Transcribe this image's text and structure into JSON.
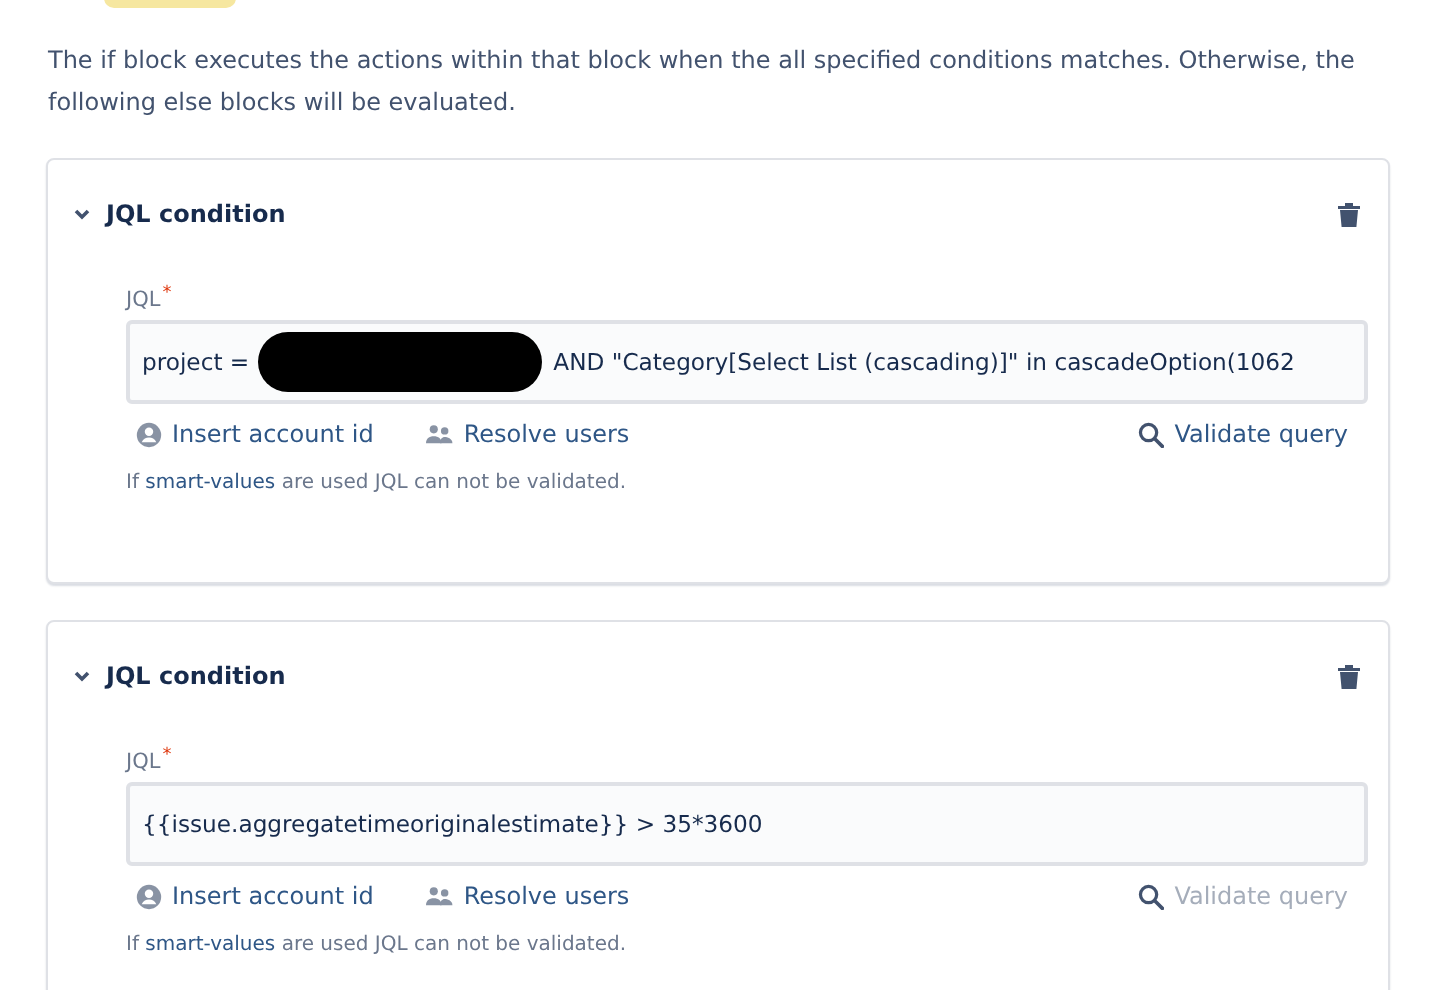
{
  "description": "The if block executes the actions within that block when the all specified conditions matches. Otherwise, the following else blocks will be evaluated.",
  "conditions": [
    {
      "title": "JQL condition",
      "expanded": true,
      "field_label": "JQL",
      "required_mark": "*",
      "value_parts": [
        {
          "kind": "text",
          "text": "project ="
        },
        {
          "kind": "redacted"
        },
        {
          "kind": "text",
          "text": "AND \"Category[Select List (cascading)]\" in cascadeOption(1062"
        }
      ],
      "actions": [
        {
          "kind": "account",
          "label": "Insert account id",
          "disabled": false
        },
        {
          "kind": "users",
          "label": "Resolve users",
          "disabled": false
        },
        {
          "kind": "validate",
          "label": "Validate query",
          "disabled": false
        }
      ],
      "help": [
        "If",
        "smart-values",
        "are used JQL can not be validated."
      ]
    },
    {
      "title": "JQL condition",
      "expanded": true,
      "field_label": "JQL",
      "required_mark": "*",
      "value_parts": [
        {
          "kind": "text",
          "text": "{{issue.aggregatetimeoriginalestimate}} > 35*3600"
        }
      ],
      "actions": [
        {
          "kind": "account",
          "label": "Insert account id",
          "disabled": false
        },
        {
          "kind": "users",
          "label": "Resolve users",
          "disabled": false
        },
        {
          "kind": "validate",
          "label": "Validate query",
          "disabled": true
        }
      ],
      "help": [
        "If",
        "smart-values",
        "are used JQL can not be validated."
      ]
    }
  ]
}
